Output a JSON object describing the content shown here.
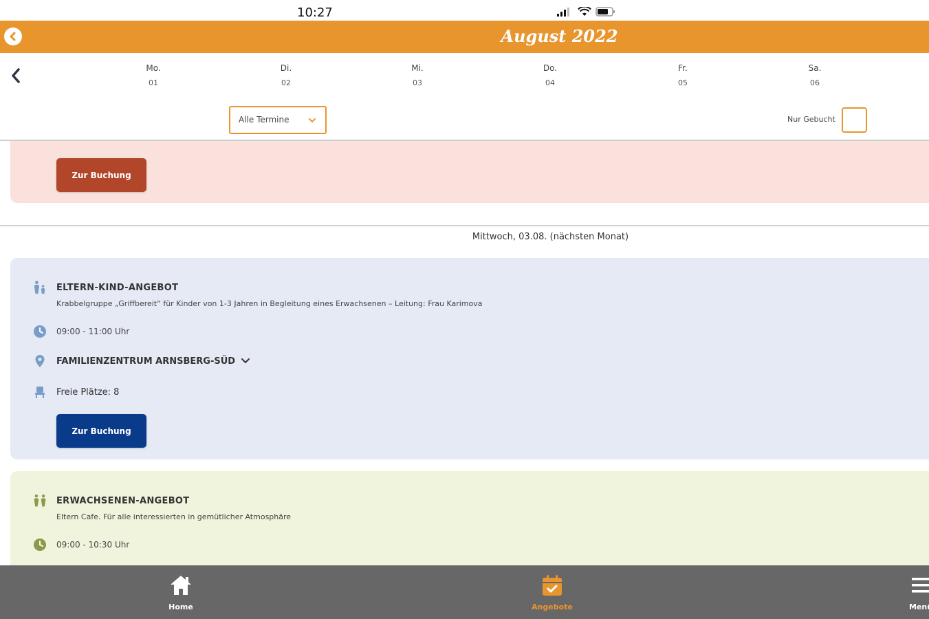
{
  "status": {
    "time": "10:27"
  },
  "header": {
    "title": "August 2022"
  },
  "week": {
    "days": [
      {
        "name": "Mo.",
        "num": "01"
      },
      {
        "name": "Di.",
        "num": "02"
      },
      {
        "name": "Mi.",
        "num": "03"
      },
      {
        "name": "Do.",
        "num": "04"
      },
      {
        "name": "Fr.",
        "num": "05"
      },
      {
        "name": "Sa.",
        "num": "06"
      }
    ]
  },
  "filter": {
    "selected": "Alle Termine",
    "booked_label": "Nur Gebucht"
  },
  "booking_label": "Zur Buchung",
  "date_heading": "Mittwoch, 03.08. (nächsten Monat)",
  "events": [
    {
      "category": "ELTERN-KIND-ANGEBOT",
      "description": "Krabbelgruppe „Griffbereit“ für Kinder von 1-3 Jahren in Begleitung eines Erwachsenen – Leitung: Frau Karimova",
      "time": "09:00 - 11:00 Uhr",
      "location": "FAMILIENZENTRUM ARNSBERG-SÜD",
      "seats": "Freie Plätze: 8"
    },
    {
      "category": "ERWACHSENEN-ANGEBOT",
      "description": "Eltern Cafe. Für alle interessierten in gemütlicher Atmosphäre",
      "time": "09:00 - 10:30 Uhr"
    }
  ],
  "nav": {
    "home": "Home",
    "offers": "Angebote",
    "menu": "Menü"
  },
  "colors": {
    "orange": "#e8952e",
    "navy": "#0a3b8a",
    "rust": "#b2462a",
    "nav_bg": "#676767"
  }
}
